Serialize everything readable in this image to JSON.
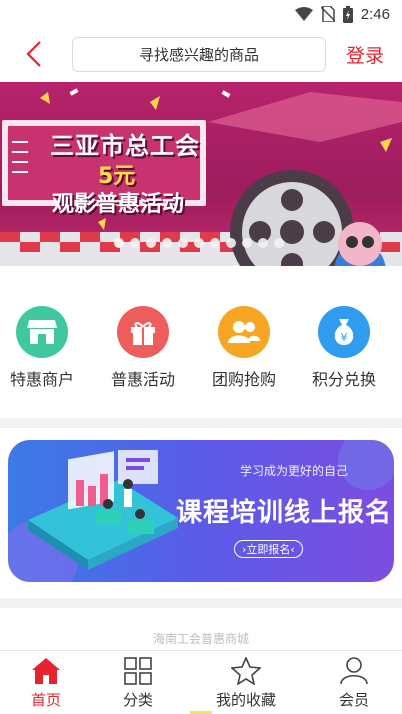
{
  "status_bar": {
    "time": "2:46"
  },
  "header": {
    "search_placeholder": "寻找感兴趣的商品",
    "login_label": "登录"
  },
  "banner": {
    "line1": "三亚市总工会",
    "line2": "5元",
    "line3": "观影普惠活动",
    "slide_count": 11,
    "active_index": 0
  },
  "shortcuts": [
    {
      "label": "特惠商户",
      "icon": "store-icon",
      "color": "#3fc7a0"
    },
    {
      "label": "普惠活动",
      "icon": "gift-icon",
      "color": "#f05d5d"
    },
    {
      "label": "团购抢购",
      "icon": "group-icon",
      "color": "#f6a623"
    },
    {
      "label": "积分兑换",
      "icon": "money-bag-icon",
      "color": "#2f9cf0"
    }
  ],
  "promo": {
    "subtitle": "学习成为更好的自己",
    "title": "课程培训线上报名",
    "button": "立即报名"
  },
  "footer_text": "海南工会普惠商城",
  "tabbar": [
    {
      "label": "首页",
      "icon": "home-icon",
      "active": true
    },
    {
      "label": "分类",
      "icon": "grid-icon",
      "active": false
    },
    {
      "label": "我的收藏",
      "icon": "star-icon",
      "active": false
    },
    {
      "label": "会员",
      "icon": "user-icon",
      "active": false
    }
  ],
  "colors": {
    "accent": "#e8232f"
  }
}
